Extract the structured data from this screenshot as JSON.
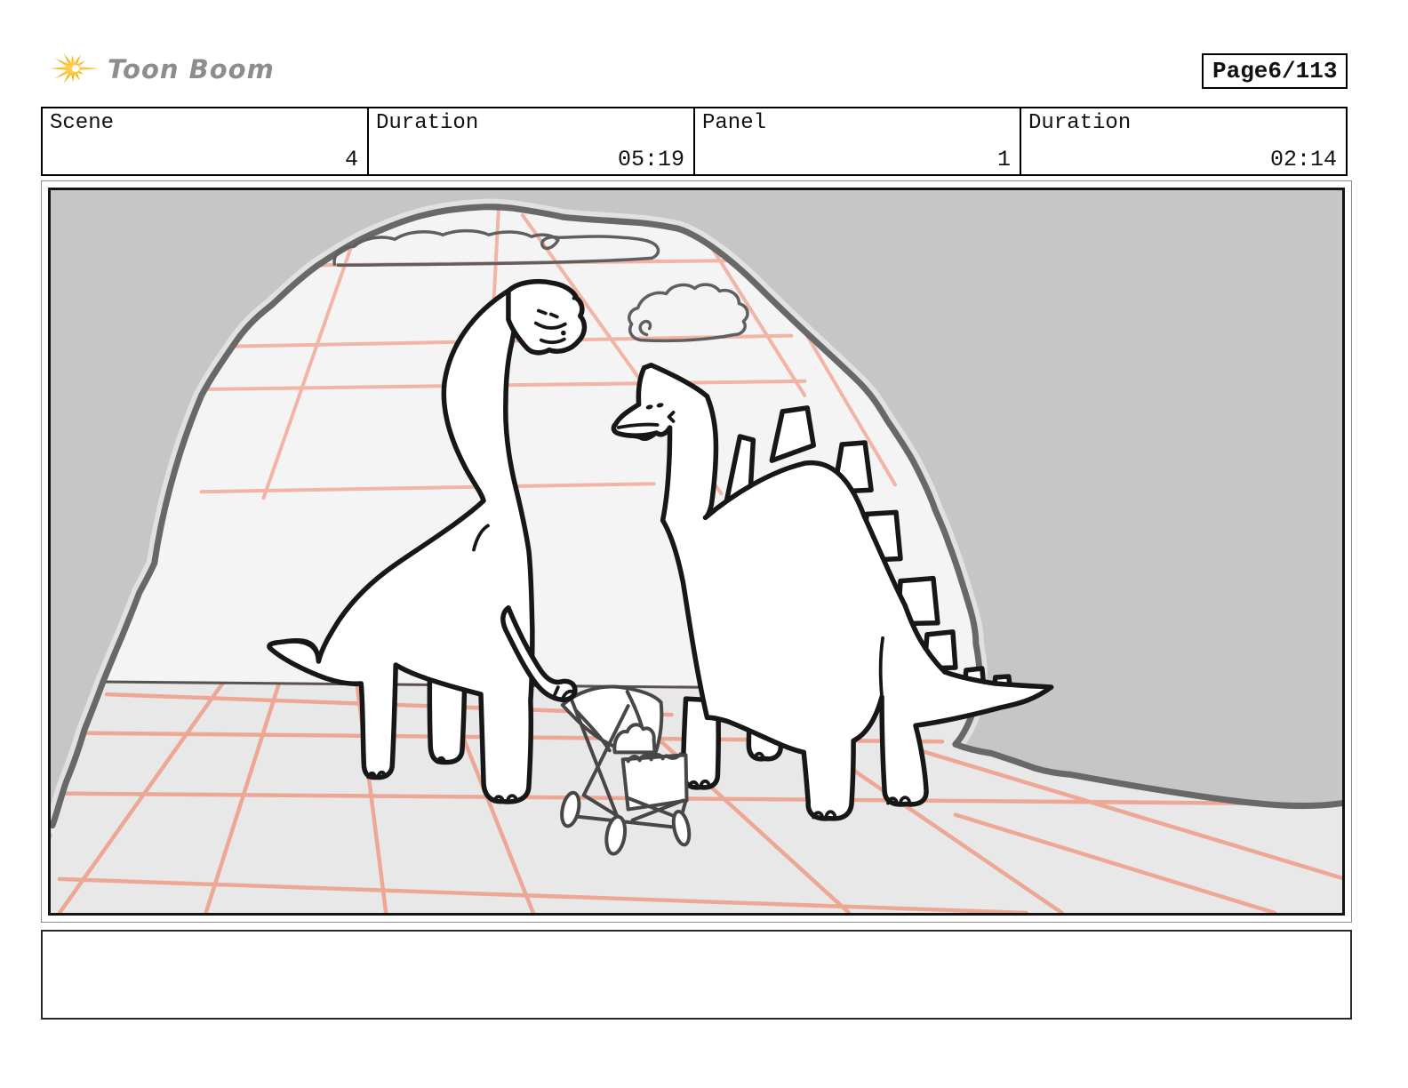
{
  "logo": {
    "brand": "Toon Boom"
  },
  "page_indicator": {
    "label": "Page",
    "value": "6/113"
  },
  "panel_info": {
    "cells": [
      {
        "label": "Scene",
        "value": "4"
      },
      {
        "label": "Duration",
        "value": "05:19"
      },
      {
        "label": "Panel",
        "value": "1"
      },
      {
        "label": "Duration",
        "value": "02:14"
      }
    ]
  },
  "caption": {
    "text": ""
  },
  "artwork": {
    "elements": [
      "cave-opening",
      "perspective-grid",
      "clouds",
      "brachiosaurus",
      "stegosaurus",
      "baby-stroller",
      "baby-dinosaur"
    ]
  },
  "colors": {
    "panel_background": "#c6c6c6",
    "cave_wall": "#f4f4f4",
    "cave_floor": "#e8e8e8",
    "cave_halo": "#e1e1e1",
    "cave_outline": "#686868",
    "wall_grid": "#f2b4a5",
    "floor_grid": "#eda795",
    "floor_line": "#5c5151",
    "ink": "#171717",
    "dino_fill": "#ffffff",
    "cloud_line": "#5f5f5f",
    "stroller_line": "#474747",
    "logo_yellow": "#f5b314",
    "logo_text": "#8d8d8d",
    "border_black": "#000000"
  }
}
